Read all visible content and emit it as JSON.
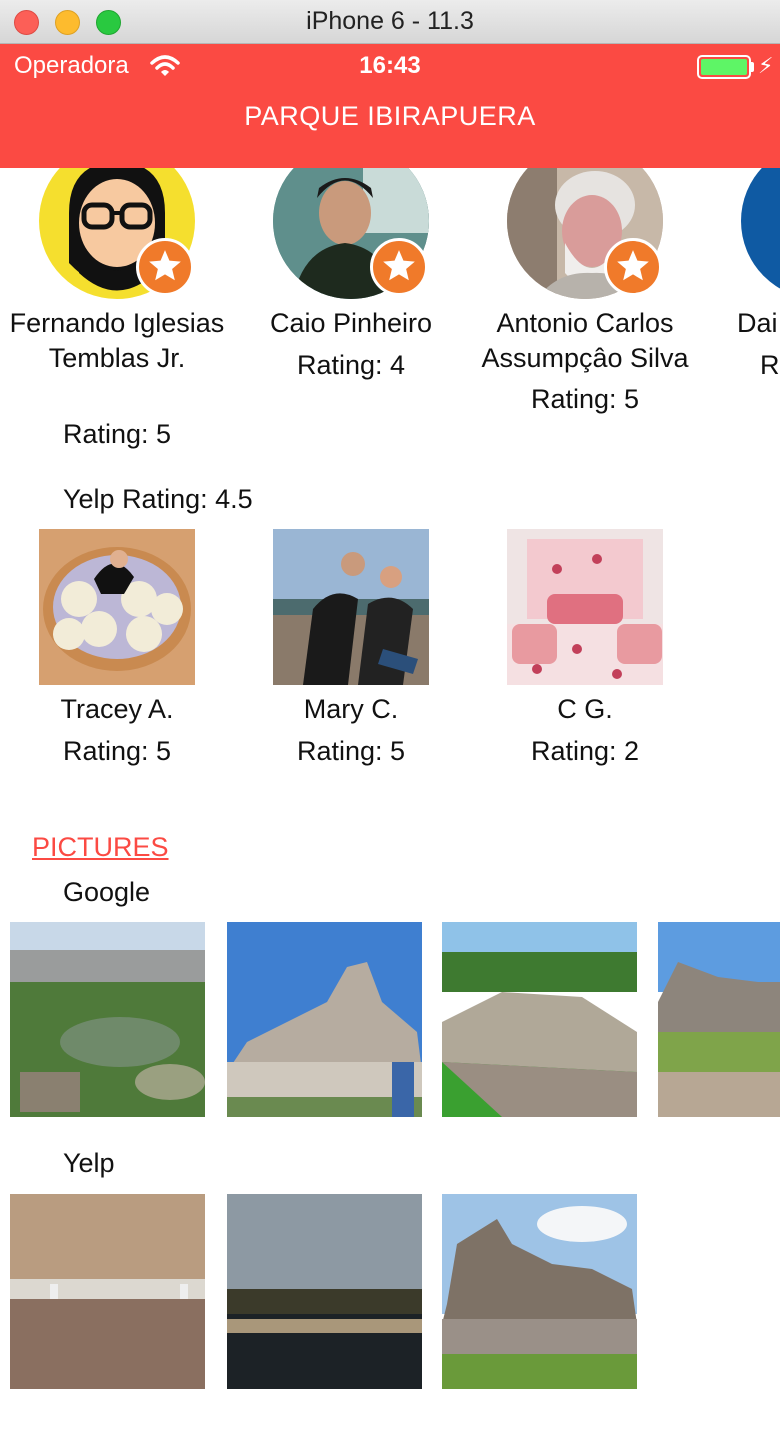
{
  "window": {
    "title": "iPhone 6 - 11.3"
  },
  "status": {
    "carrier": "Operadora",
    "time": "16:43",
    "battery_level": 1.0
  },
  "nav": {
    "title": "PARQUE IBIRAPUERA"
  },
  "users": [
    {
      "name": "Fernando Iglesias Temblas Jr.",
      "rating": "Rating: 5"
    },
    {
      "name": "Caio Pinheiro",
      "rating": "Rating: 4"
    },
    {
      "name": "Antonio Carlos Assumpçâo Silva",
      "rating": "Rating: 5"
    },
    {
      "name": "Dai",
      "rating": "Ra"
    }
  ],
  "yelp": {
    "label": "Yelp Rating: 4.5",
    "reviews": [
      {
        "name": "Tracey A.",
        "rating": "Rating: 5"
      },
      {
        "name": "Mary C.",
        "rating": "Rating: 5"
      },
      {
        "name": "C G.",
        "rating": "Rating: 2"
      }
    ]
  },
  "pictures": {
    "heading": "PICTURES",
    "google_label": "Google",
    "yelp_label": "Yelp"
  },
  "colors": {
    "accent": "#fb4a43",
    "badge": "#f07a2a"
  },
  "icons": [
    "wifi-icon",
    "battery-icon",
    "charging-bolt-icon",
    "star-badge-icon"
  ]
}
